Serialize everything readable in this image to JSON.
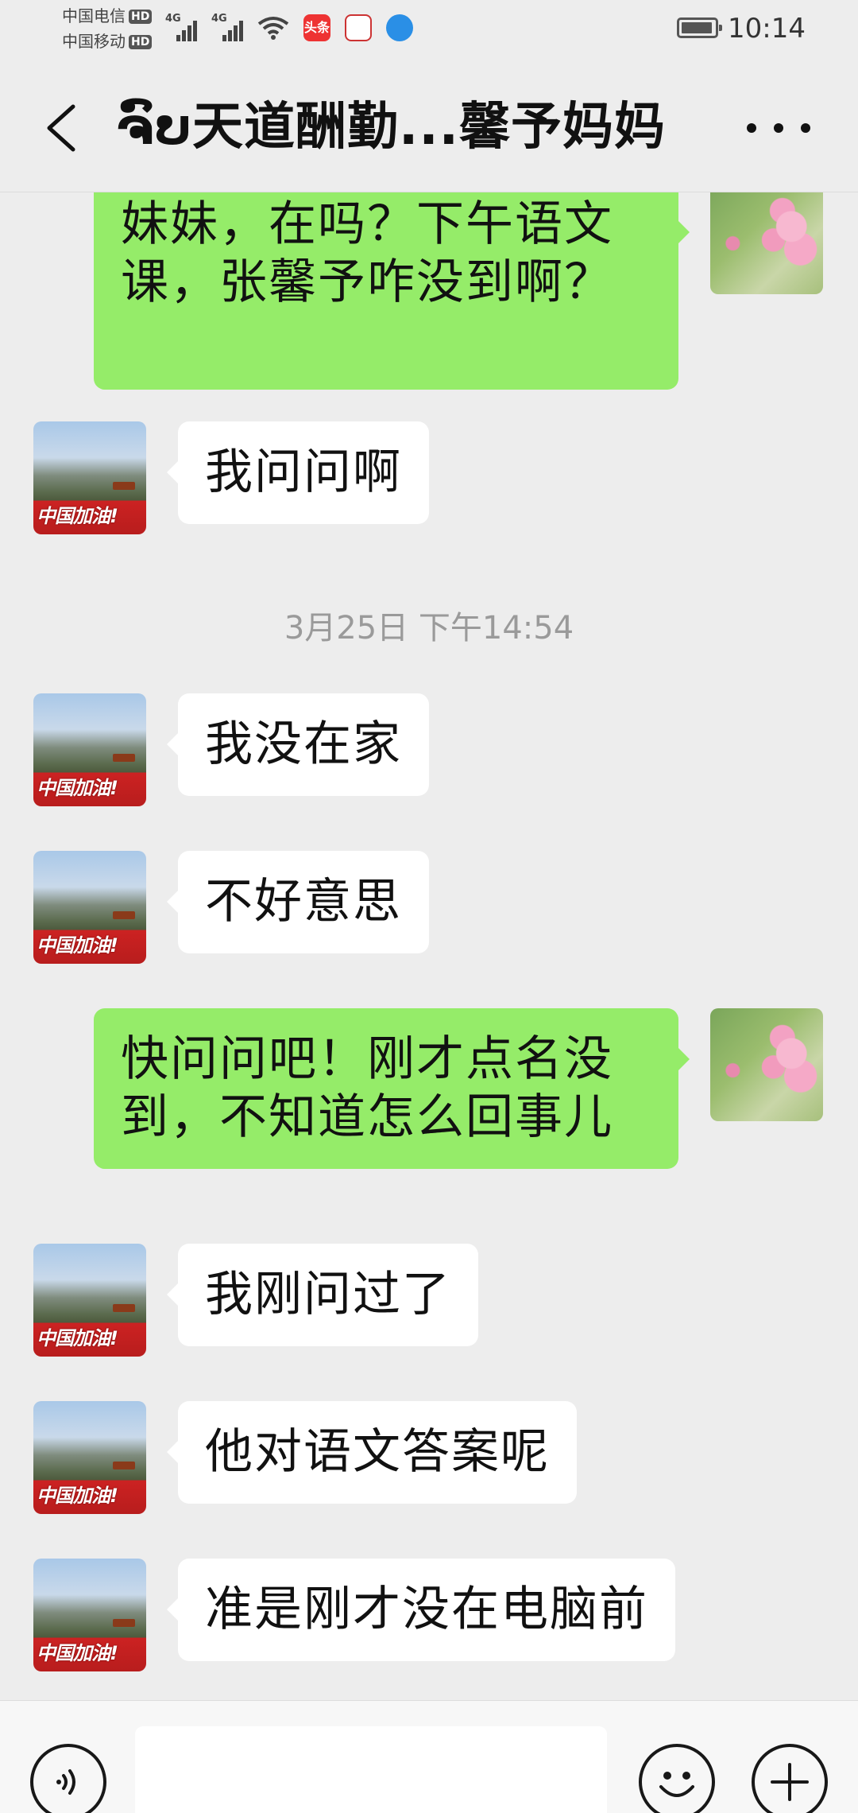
{
  "status_bar": {
    "carrier_1": "中国电信",
    "carrier_2": "中国移动",
    "hd_badge": "HD",
    "network_1": "4G",
    "network_2": "4G",
    "app_icon_toutiao": "头条",
    "time": "10:14"
  },
  "header": {
    "title": "ຈົບ天道酬勤...馨予妈妈",
    "back_icon": "chevron-left-icon",
    "more_icon": "more-dots-icon"
  },
  "messages": [
    {
      "side": "out",
      "text_line1": "妹妹，在吗？下午语文",
      "text_line2": "课，张馨予咋没到啊？"
    },
    {
      "side": "in",
      "text": "我问问啊",
      "avatar_badge": "中国加油!"
    },
    {
      "side": "in",
      "text": "我没在家",
      "avatar_badge": "中国加油!"
    },
    {
      "side": "in",
      "text": "不好意思",
      "avatar_badge": "中国加油!"
    },
    {
      "side": "out",
      "text_line1": "快问问吧！刚才点名没",
      "text_line2": "到，不知道怎么回事儿"
    },
    {
      "side": "in",
      "text": "我刚问过了",
      "avatar_badge": "中国加油!"
    },
    {
      "side": "in",
      "text": "他对语文答案呢",
      "avatar_badge": "中国加油!"
    },
    {
      "side": "in",
      "text": "准是刚才没在电脑前",
      "avatar_badge": "中国加油!"
    }
  ],
  "timestamp": "3月25日 下午14:54",
  "input_bar": {
    "voice_icon": "voice-icon",
    "emoji_icon": "emoji-icon",
    "plus_icon": "plus-icon",
    "input_value": ""
  },
  "colors": {
    "outgoing_bubble": "#95ec69",
    "incoming_bubble": "#ffffff",
    "background": "#ededed"
  }
}
